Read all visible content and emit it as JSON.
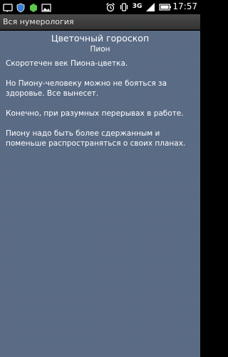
{
  "status_bar": {
    "network": "3G",
    "time": "17:57",
    "icons": [
      "notification-icon",
      "shield-icon",
      "app-icon",
      "image-icon",
      "alarm-icon",
      "vibrate-icon",
      "signal-icon",
      "battery-icon"
    ]
  },
  "app": {
    "title": "Вся нумерология"
  },
  "horoscope": {
    "title": "Цветочный гороскоп",
    "flower": "Пион",
    "paragraphs": [
      "Скоротечен век Пиона-цветка.",
      "Но Пиону-человеку можно не бояться за здоровье. Все вынесет.",
      "Конечно, при разумных перерывах в работе.",
      "Пиону надо быть более сдержанным и поменьше распространяться о своих планах."
    ]
  },
  "colors": {
    "background": "#5a6b85",
    "text": "#ffffff"
  }
}
